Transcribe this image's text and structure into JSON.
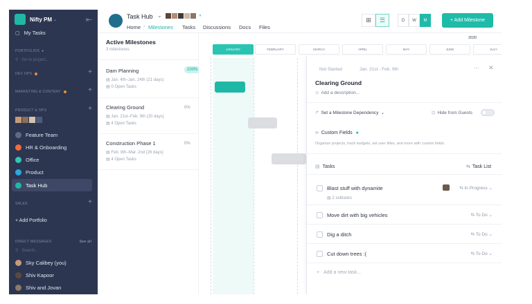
{
  "workspace": {
    "name": "Nifty PM"
  },
  "sidebar": {
    "my_tasks": "My Tasks",
    "portfolios_label": "PORTFOLIOS",
    "search_placeholder": "Go to project...",
    "sections": {
      "dev_ops": "DEV OPS",
      "marketing": "MARKETING & CONTENT",
      "product_ops": "PRODUCT & OPS",
      "sales": "SALES"
    },
    "projects": [
      {
        "label": "Feature Team",
        "color": "#5f6b86"
      },
      {
        "label": "HR & Onboarding",
        "color": "#f26b3a"
      },
      {
        "label": "Office",
        "color": "#34c6b2"
      },
      {
        "label": "Product",
        "color": "#2ea7e0"
      },
      {
        "label": "Task Hub",
        "color": "#20b7a5"
      }
    ],
    "add_portfolio": "+ Add Portfolio",
    "direct_messages_label": "DIRECT MESSAGES",
    "see_all": "See all",
    "dm_search_placeholder": "Search...",
    "dms": [
      "Sky Calibey (you)",
      "Shiv Kapoor",
      "Shiv and Jovan"
    ]
  },
  "header": {
    "project_title": "Task Hub",
    "tabs": [
      "Home",
      "Milestones",
      "Tasks",
      "Discussions",
      "Docs",
      "Files"
    ],
    "active_tab": "Milestones",
    "view_letters": [
      "D",
      "W",
      "M"
    ],
    "add_milestone": "+ Add Milestone",
    "year": "2020"
  },
  "milestones": {
    "heading": "Active Milestones",
    "count": "3 milestones",
    "items": [
      {
        "name": "Dam Planning",
        "dates": "Jan. 4th–Jan. 24th (21 days)",
        "tasks": "0 Open Tasks",
        "progress": "100%"
      },
      {
        "name": "Clearing Ground",
        "dates": "Jan. 21st–Feb. 9th (20 days)",
        "tasks": "4 Open Tasks",
        "progress": "0%"
      },
      {
        "name": "Construction Phase 1",
        "dates": "Feb. 8th–Mar. 2nd (26 days)",
        "tasks": "4 Open Tasks",
        "progress": "0%"
      }
    ]
  },
  "timeline": {
    "months": [
      "JANUARY",
      "FEBRUARY",
      "MARCH",
      "APRIL",
      "MAY",
      "JUNE",
      "JULY"
    ],
    "bar_colors": {
      "complete": "#1fb8a6",
      "pending": "#dcdde0"
    }
  },
  "panel": {
    "status": "Not Started",
    "date_range": "Jan. 21st - Feb. 9th",
    "title": "Clearing Ground",
    "description_placeholder": "Add a description...",
    "dependency_label": "Set a Milestone Dependency",
    "hide_guests_label": "Hide from Guests",
    "custom_fields_label": "Custom Fields",
    "custom_fields_hint": "Organize projects, track budgets, set user titles, and more with custom fields.",
    "tasks_label": "Tasks",
    "task_list_label": "Task List",
    "tasks": [
      {
        "name": "Blast stuff with dynamite",
        "status": "In Progress",
        "subtasks": "2 subtasks"
      },
      {
        "name": "Move dirt with big vehicles",
        "status": "To Do"
      },
      {
        "name": "Dig a ditch",
        "status": "To Do"
      },
      {
        "name": "Cut down trees :(",
        "status": "To Do"
      }
    ],
    "add_task_placeholder": "Add a new task..."
  }
}
